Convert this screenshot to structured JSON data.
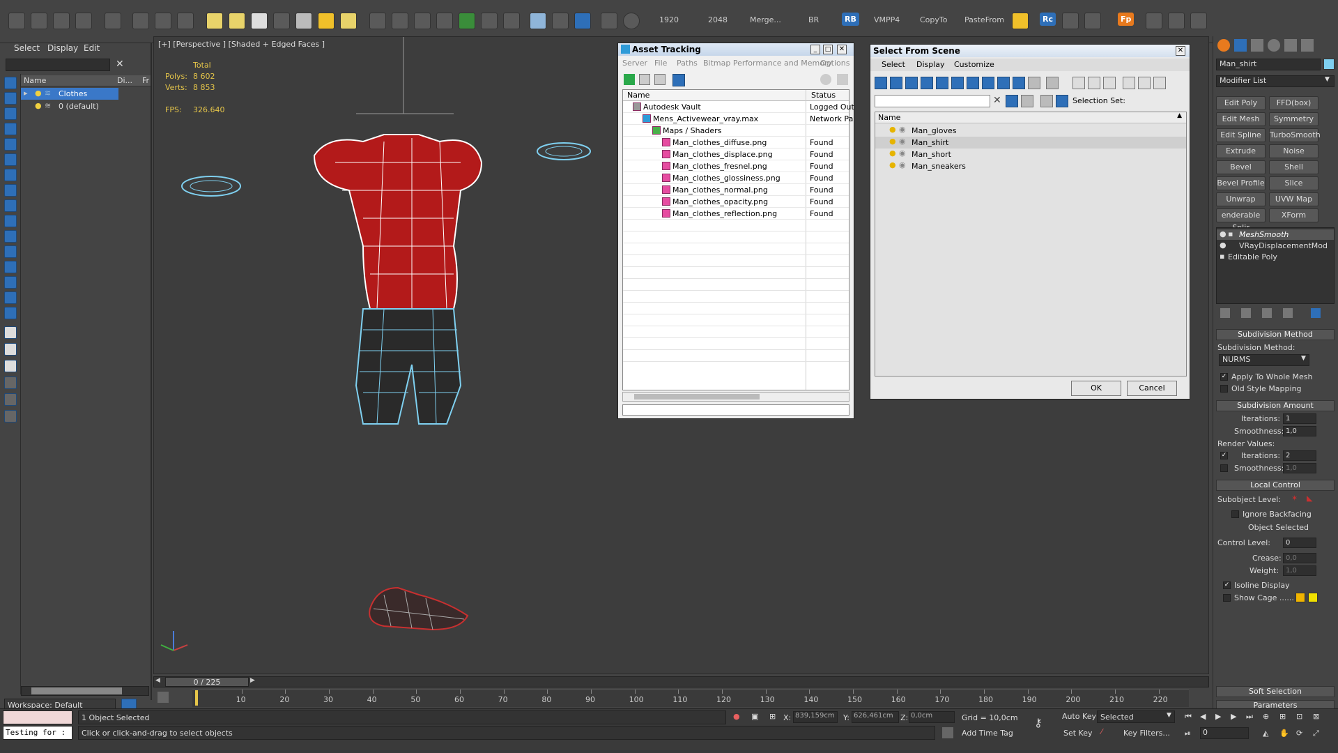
{
  "toolbar": {
    "texts": [
      "1920",
      "2048",
      "Merge...",
      "BR",
      "RB",
      "VMPP4",
      "CopyTo",
      "PasteFrom",
      "Rc",
      "Fp"
    ]
  },
  "scene_explorer": {
    "menus": [
      "Select",
      "Display",
      "Edit"
    ],
    "columns": [
      "Name",
      "Di...",
      "Fr"
    ],
    "items": [
      {
        "label": "Clothes",
        "selected": true
      },
      {
        "label": "0 (default)",
        "selected": false
      }
    ],
    "workspace_label": "Workspace: Default"
  },
  "viewport": {
    "label": "[+] [Perspective ] [Shaded + Edged Faces ]",
    "stats": {
      "total_label": "Total",
      "polys_label": "Polys:",
      "polys_value": "8 602",
      "verts_label": "Verts:",
      "verts_value": "8 853",
      "fps_label": "FPS:",
      "fps_value": "326.640"
    }
  },
  "asset_tracking": {
    "title": "Asset Tracking",
    "menus": [
      "Server",
      "File",
      "Paths",
      "Bitmap Performance and Memory",
      "Options"
    ],
    "columns": [
      "Name",
      "Status"
    ],
    "rows": [
      {
        "name": "Autodesk Vault",
        "status": "Logged Out",
        "indent": 1
      },
      {
        "name": "Mens_Activewear_vray.max",
        "status": "Network Pa",
        "indent": 2
      },
      {
        "name": "Maps / Shaders",
        "status": "",
        "indent": 3
      },
      {
        "name": "Man_clothes_diffuse.png",
        "status": "Found",
        "indent": 4
      },
      {
        "name": "Man_clothes_displace.png",
        "status": "Found",
        "indent": 4
      },
      {
        "name": "Man_clothes_fresnel.png",
        "status": "Found",
        "indent": 4
      },
      {
        "name": "Man_clothes_glossiness.png",
        "status": "Found",
        "indent": 4
      },
      {
        "name": "Man_clothes_normal.png",
        "status": "Found",
        "indent": 4
      },
      {
        "name": "Man_clothes_opacity.png",
        "status": "Found",
        "indent": 4
      },
      {
        "name": "Man_clothes_reflection.png",
        "status": "Found",
        "indent": 4
      }
    ]
  },
  "select_from_scene": {
    "title": "Select From Scene",
    "menus": [
      "Select",
      "Display",
      "Customize"
    ],
    "selection_set_label": "Selection Set:",
    "column": "Name",
    "items": [
      {
        "label": "Man_gloves",
        "selected": false
      },
      {
        "label": "Man_shirt",
        "selected": true
      },
      {
        "label": "Man_short",
        "selected": false
      },
      {
        "label": "Man_sneakers",
        "selected": false
      }
    ],
    "ok_label": "OK",
    "cancel_label": "Cancel"
  },
  "command_panel": {
    "object_name": "Man_shirt",
    "modifier_list_label": "Modifier List",
    "buttons": [
      "Edit Poly",
      "FFD(box)",
      "Edit Mesh",
      "Symmetry",
      "Edit Spline",
      "TurboSmooth",
      "Extrude",
      "Noise",
      "Bevel",
      "Shell",
      "Bevel Profile",
      "Slice",
      "Unwrap UVW",
      "UVW Map",
      "enderable Splir",
      "XForm"
    ],
    "stack": [
      {
        "label": "MeshSmooth",
        "active": true
      },
      {
        "label": "VRayDisplacementMod",
        "active": false
      },
      {
        "label": "Editable Poly",
        "active": false
      }
    ],
    "subdivision_method": {
      "header": "Subdivision Method",
      "label": "Subdivision Method:",
      "value": "NURMS",
      "apply_whole_mesh": "Apply To Whole Mesh",
      "old_style_mapping": "Old Style Mapping"
    },
    "subdivision_amount": {
      "header": "Subdivision Amount",
      "iterations_label": "Iterations:",
      "iterations_value": "1",
      "smoothness_label": "Smoothness:",
      "smoothness_value": "1,0",
      "render_values_label": "Render Values:",
      "render_iterations_label": "Iterations:",
      "render_iterations_value": "2",
      "render_smoothness_label": "Smoothness:",
      "render_smoothness_value": "1,0"
    },
    "local_control": {
      "header": "Local Control",
      "subobject_level_label": "Subobject Level:",
      "ignore_backfacing": "Ignore Backfacing",
      "object_selected": "Object Selected",
      "control_level_label": "Control Level:",
      "control_level_value": "0",
      "crease_label": "Crease:",
      "crease_value": "0,0",
      "weight_label": "Weight:",
      "weight_value": "1,0",
      "isoline_display": "Isoline Display",
      "show_cage": "Show Cage ......"
    },
    "soft_selection_header": "Soft Selection",
    "parameters_header": "Parameters"
  },
  "timeline": {
    "frame_label": "0 / 225",
    "ticks": [
      "10",
      "20",
      "30",
      "40",
      "50",
      "60",
      "70",
      "80",
      "90",
      "100",
      "110",
      "120",
      "130",
      "140",
      "150",
      "160",
      "170",
      "180",
      "190",
      "200",
      "210",
      "220"
    ]
  },
  "status": {
    "maxscript_text": "Testing for :",
    "selected_info": "1 Object Selected",
    "prompt": "Click or click-and-drag to select objects",
    "x_label": "X:",
    "x_value": "839,159cm",
    "y_label": "Y:",
    "y_value": "626,461cm",
    "z_label": "Z:",
    "z_value": "0,0cm",
    "grid": "Grid = 10,0cm",
    "add_time_tag": "Add Time Tag",
    "auto_key": "Auto Key",
    "set_key": "Set Key",
    "selected_dropdown": "Selected",
    "key_filters": "Key Filters...",
    "frame_value": "0"
  },
  "colors": {
    "accent_blue": "#2e6fb8",
    "selected_row": "#3a78c8",
    "stat_yellow": "#e6c64a"
  }
}
